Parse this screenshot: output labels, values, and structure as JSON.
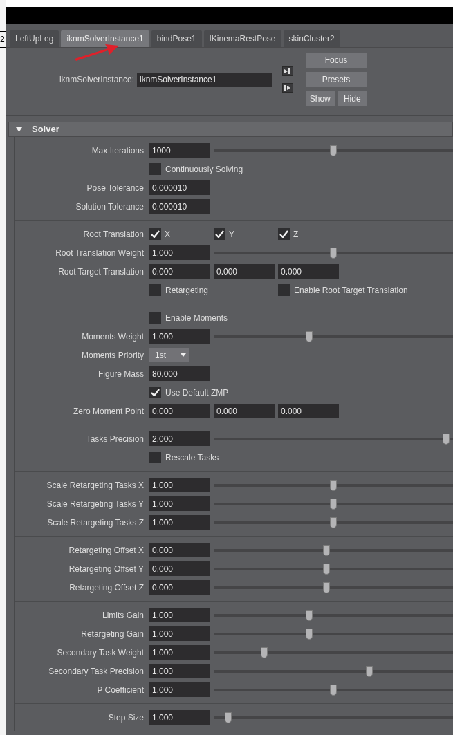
{
  "behind_window_text": "2",
  "tabs": [
    {
      "label": "LeftUpLeg",
      "selected": false
    },
    {
      "label": "iknmSolverInstance1",
      "selected": true
    },
    {
      "label": "bindPose1",
      "selected": false
    },
    {
      "label": "IKinemaRestPose",
      "selected": false
    },
    {
      "label": "skinCluster2",
      "selected": false
    }
  ],
  "node": {
    "label": "iknmSolverInstance:",
    "value": "iknmSolverInstance1"
  },
  "buttons": {
    "focus": "Focus",
    "presets": "Presets",
    "show": "Show",
    "hide": "Hide"
  },
  "section": {
    "title": "Solver",
    "expanded": true
  },
  "groups": [
    [
      {
        "kind": "slider",
        "label": "Max Iterations",
        "value": "1000",
        "level": 0.5
      },
      {
        "kind": "checkbox",
        "text": "Continuously Solving",
        "checked": false
      },
      {
        "kind": "field",
        "label": "Pose Tolerance",
        "value": "0.000010"
      },
      {
        "kind": "field",
        "label": "Solution Tolerance",
        "value": "0.000010"
      }
    ],
    [
      {
        "kind": "checks",
        "label": "Root Translation",
        "items": [
          {
            "text": "X",
            "checked": true
          },
          {
            "text": "Y",
            "checked": true
          },
          {
            "text": "Z",
            "checked": true
          }
        ]
      },
      {
        "kind": "slider",
        "label": "Root Translation Weight",
        "value": "1.000",
        "level": 0.5
      },
      {
        "kind": "vector",
        "label": "Root Target Translation",
        "values": [
          "0.000",
          "0.000",
          "0.000"
        ]
      },
      {
        "kind": "check_pair",
        "items": [
          {
            "text": "Retargeting",
            "checked": false
          },
          {
            "text": "Enable Root Target Translation",
            "checked": false
          }
        ]
      }
    ],
    [
      {
        "kind": "checkbox",
        "text": "Enable Moments",
        "checked": false
      },
      {
        "kind": "slider",
        "label": "Moments Weight",
        "value": "1.000",
        "level": 0.4
      },
      {
        "kind": "dropdown",
        "label": "Moments Priority",
        "value": "1st"
      },
      {
        "kind": "field",
        "label": "Figure Mass",
        "value": "80.000"
      },
      {
        "kind": "checkbox",
        "text": "Use Default ZMP",
        "checked": true
      },
      {
        "kind": "vector",
        "label": "Zero Moment Point",
        "values": [
          "0.000",
          "0.000",
          "0.000"
        ]
      }
    ],
    [
      {
        "kind": "slider",
        "label": "Tasks Precision",
        "value": "2.000",
        "level": 0.97
      },
      {
        "kind": "checkbox",
        "text": "Rescale Tasks",
        "checked": false
      }
    ],
    [
      {
        "kind": "slider",
        "label": "Scale Retargeting Tasks X",
        "value": "1.000",
        "level": 0.5
      },
      {
        "kind": "slider",
        "label": "Scale Retargeting Tasks Y",
        "value": "1.000",
        "level": 0.5
      },
      {
        "kind": "slider",
        "label": "Scale Retargeting Tasks Z",
        "value": "1.000",
        "level": 0.5
      }
    ],
    [
      {
        "kind": "slider",
        "label": "Retargeting Offset X",
        "value": "0.000",
        "level": 0.47
      },
      {
        "kind": "slider",
        "label": "Retargeting Offset Y",
        "value": "0.000",
        "level": 0.47
      },
      {
        "kind": "slider",
        "label": "Retargeting Offset Z",
        "value": "0.000",
        "level": 0.47
      }
    ],
    [
      {
        "kind": "slider",
        "label": "Limits Gain",
        "value": "1.000",
        "level": 0.4
      },
      {
        "kind": "slider",
        "label": "Retargeting Gain",
        "value": "1.000",
        "level": 0.4
      },
      {
        "kind": "slider",
        "label": "Secondary Task Weight",
        "value": "1.000",
        "level": 0.21
      },
      {
        "kind": "slider",
        "label": "Secondary Task Precision",
        "value": "1.000",
        "level": 0.65
      },
      {
        "kind": "slider",
        "label": "P Coefficient",
        "value": "1.000",
        "level": 0.5
      }
    ],
    [
      {
        "kind": "slider",
        "label": "Step Size",
        "value": "1.000",
        "level": 0.06
      }
    ]
  ]
}
